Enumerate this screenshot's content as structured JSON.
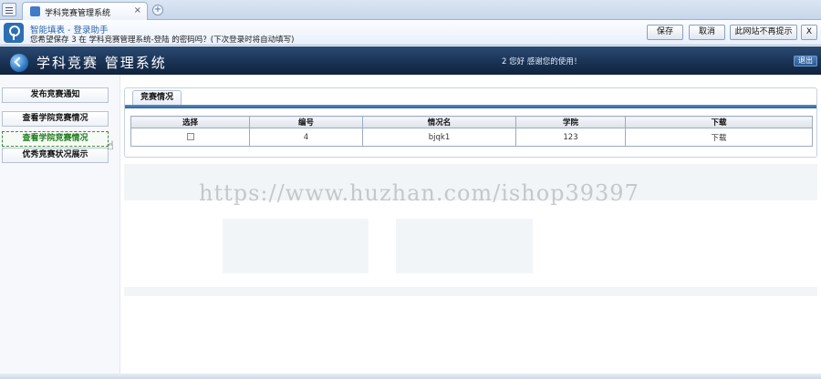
{
  "browser": {
    "tab_title": "学科竞赛管理系统",
    "tab_close": "×",
    "new_tab": "+"
  },
  "autofill": {
    "title": "智能填表 - 登录助手",
    "message": "您希望保存 3 在 学科竞赛管理系统-登陆 的密码吗？(下次登录时将自动填写)",
    "save_label": "保存",
    "cancel_label": "取消",
    "never_label": "此网站不再提示",
    "close_label": "X"
  },
  "header": {
    "title": "学科竞赛 管理系统",
    "welcome": "2 您好 感谢您的使用！",
    "logout_label": "退出"
  },
  "sidebar": {
    "items": [
      {
        "label": "发布竞赛通知"
      },
      {
        "label": "查看学院竞赛情况"
      },
      {
        "label": "查看学院竞赛情况"
      },
      {
        "label": "优秀竞赛状况展示"
      }
    ]
  },
  "panel": {
    "tab_label": "竞赛情况",
    "columns": [
      "选择",
      "编号",
      "情况名",
      "学院",
      "下载"
    ],
    "rows": [
      {
        "id": "4",
        "name": "bjqk1",
        "college": "123",
        "download": "下载"
      }
    ]
  },
  "watermark": "https://www.huzhan.com/ishop39397",
  "colors": {
    "header_bg": "#1a3355",
    "panel_rule": "#2e5f9c",
    "active_nav": "#1d7a1d"
  }
}
